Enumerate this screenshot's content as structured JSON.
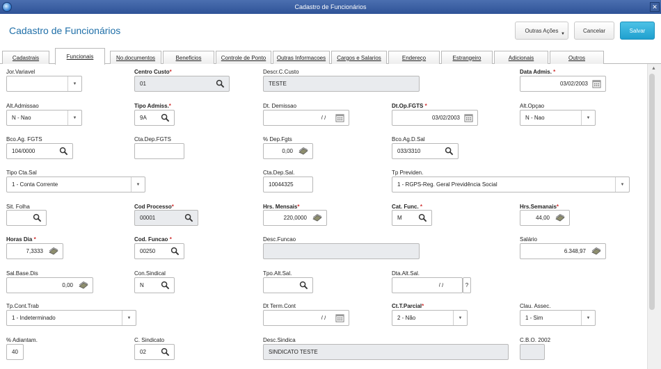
{
  "window": {
    "title": "Cadastro de Funcionários"
  },
  "header": {
    "title": "Cadastro de Funcionários",
    "btn_outras": "Outras Ações",
    "btn_cancel": "Cancelar",
    "btn_save": "Salvar",
    "save_color": "#1fa0cf"
  },
  "tabs": [
    "Cadastrais",
    "Funcionais",
    "No.documentos",
    "Beneficios",
    "Controle de Ponto",
    "Outras Informacoes",
    "Cargos e Salarios",
    "Endereço",
    "Estrangeiro",
    "Adicionais",
    "Outros"
  ],
  "active_tab": "Funcionais",
  "form": {
    "jor_variavel": {
      "label": "Jor.Variavel",
      "value": ""
    },
    "centro_custo": {
      "label": "Centro Custo",
      "value": "01"
    },
    "descr_ccusto": {
      "label": "Descr.C.Custo",
      "value": "TESTE"
    },
    "data_admis": {
      "label": "Data Admis.",
      "value": "03/02/2003"
    },
    "alt_admissao": {
      "label": "Alt.Admissao",
      "value": "N - Nao"
    },
    "tipo_admiss": {
      "label": "Tipo Admiss.",
      "value": "9A"
    },
    "dt_demissao": {
      "label": "Dt. Demissao",
      "value": "/ /"
    },
    "dt_op_fgts": {
      "label": "Dt.Op.FGTS",
      "value": "03/02/2003"
    },
    "alt_opcao": {
      "label": "Alt.Opçao",
      "value": "N - Nao"
    },
    "bco_ag_fgts": {
      "label": "Bco.Ag. FGTS",
      "value": "104/0000"
    },
    "cta_dep_fgts": {
      "label": "Cta.Dep.FGTS",
      "value": ""
    },
    "dep_fgts": {
      "label": "% Dep.Fgts",
      "value": "0,00"
    },
    "bco_ag_dsal": {
      "label": "Bco.Ag.D.Sal",
      "value": "033/3310"
    },
    "tipo_cta_sal": {
      "label": "Tipo Cta.Sal",
      "value": "1 - Conta Corrente"
    },
    "cta_dep_sal": {
      "label": "Cta.Dep.Sal.",
      "value": "10044325"
    },
    "tp_previden": {
      "label": "Tp Previden.",
      "value": "1 - RGPS-Reg. Geral Previdência Social"
    },
    "sit_folha": {
      "label": "Sit. Folha",
      "value": ""
    },
    "cod_processo": {
      "label": "Cod Processo",
      "value": "00001"
    },
    "hrs_mensais": {
      "label": "Hrs. Mensais",
      "value": "220,0000"
    },
    "cat_func": {
      "label": "Cat. Func.",
      "value": "M"
    },
    "hrs_semanais": {
      "label": "Hrs.Semanais",
      "value": "44,00"
    },
    "horas_dia": {
      "label": "Horas Dia",
      "value": "7,3333"
    },
    "cod_funcao": {
      "label": "Cod. Funcao",
      "value": "00250"
    },
    "desc_funcao": {
      "label": "Desc.Funcao",
      "value": ""
    },
    "salario": {
      "label": "Salário",
      "value": "6.348,97"
    },
    "sal_base_dis": {
      "label": "Sal.Base.Dis",
      "value": "0,00"
    },
    "con_sindical": {
      "label": "Con.Sindical",
      "value": "N"
    },
    "tpo_alt_sal": {
      "label": "Tpo.Alt.Sal.",
      "value": ""
    },
    "dta_alt_sal": {
      "label": "Dta.Alt.Sal.",
      "value": "/ /"
    },
    "help_mark": "?",
    "tp_cont_trab": {
      "label": "Tp.Cont.Trab",
      "value": "1 - Indeterminado"
    },
    "dt_term_cont": {
      "label": "Dt Term.Cont",
      "value": "/ /"
    },
    "ct_t_parcial": {
      "label": "Ct.T.Parcial",
      "value": "2 - Não"
    },
    "clau_assec": {
      "label": "Clau. Assec.",
      "value": "1 - Sim"
    },
    "adiantam": {
      "label": "% Adiantam.",
      "value": "40"
    },
    "c_sindicato": {
      "label": "C. Sindicato",
      "value": "02"
    },
    "desc_sindica": {
      "label": "Desc.Sindica",
      "value": "SINDICATO TESTE"
    },
    "cbo_2002": {
      "label": "C.B.O. 2002",
      "value": ""
    }
  },
  "required_mark": "*",
  "highlight_color": "#e6f014"
}
